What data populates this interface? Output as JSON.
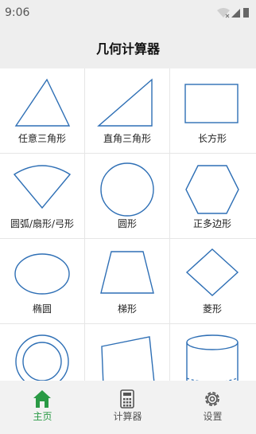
{
  "status_bar": {
    "time": "9:06"
  },
  "app_bar": {
    "title": "几何计算器"
  },
  "shapes": [
    {
      "label": "任意三角形",
      "icon": "triangle-icon"
    },
    {
      "label": "直角三角形",
      "icon": "right-triangle-icon"
    },
    {
      "label": "长方形",
      "icon": "rectangle-icon"
    },
    {
      "label": "圆弧/扇形/弓形",
      "icon": "sector-icon"
    },
    {
      "label": "圆形",
      "icon": "circle-icon"
    },
    {
      "label": "正多边形",
      "icon": "hexagon-icon"
    },
    {
      "label": "椭圆",
      "icon": "ellipse-icon"
    },
    {
      "label": "梯形",
      "icon": "trapezoid-icon"
    },
    {
      "label": "菱形",
      "icon": "rhombus-icon"
    },
    {
      "label": "",
      "icon": "annulus-icon"
    },
    {
      "label": "",
      "icon": "quadrilateral-icon"
    },
    {
      "label": "",
      "icon": "cylinder-icon"
    }
  ],
  "bottom_nav": [
    {
      "label": "主页",
      "icon": "home-icon",
      "active": true
    },
    {
      "label": "计算器",
      "icon": "calculator-icon",
      "active": false
    },
    {
      "label": "设置",
      "icon": "gear-icon",
      "active": false
    }
  ],
  "colors": {
    "shape_stroke": "#2e6fb5",
    "active_green": "#2a9a45",
    "bar_bg": "#eeeeee"
  }
}
